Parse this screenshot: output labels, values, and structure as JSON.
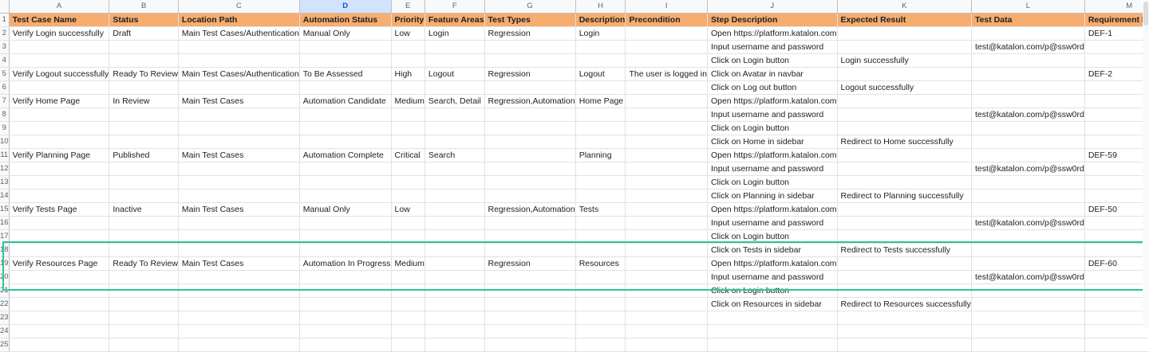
{
  "columns": [
    "A",
    "B",
    "C",
    "D",
    "E",
    "F",
    "G",
    "H",
    "I",
    "J",
    "K",
    "L",
    "M"
  ],
  "selected_column": "D",
  "header": [
    "Test Case Name",
    "Status",
    "Location Path",
    "Automation Status",
    "Priority",
    "Feature Areas",
    "Test Types",
    "Description",
    "Precondition",
    "Step Description",
    "Expected Result",
    "Test Data",
    "Requirement Linkage"
  ],
  "rows": [
    [
      "Verify Login successfully",
      "Draft",
      "Main Test Cases/Authentication",
      "Manual Only",
      "Low",
      "Login",
      "Regression",
      "Login",
      "",
      "Open https://platform.katalon.com",
      "",
      "",
      "DEF-1"
    ],
    [
      "",
      "",
      "",
      "",
      "",
      "",
      "",
      "",
      "",
      "Input username and password",
      "",
      "test@katalon.com/p@ssw0rd",
      ""
    ],
    [
      "",
      "",
      "",
      "",
      "",
      "",
      "",
      "",
      "",
      "Click on Login button",
      "Login successfully",
      "",
      ""
    ],
    [
      "Verify Logout successfully",
      "Ready To Review",
      "Main Test Cases/Authentication",
      "To Be Assessed",
      "High",
      "Logout",
      "Regression",
      "Logout",
      "The user is logged in",
      "Click on Avatar in navbar",
      "",
      "",
      "DEF-2"
    ],
    [
      "",
      "",
      "",
      "",
      "",
      "",
      "",
      "",
      "",
      "Click on Log out button",
      "Logout successfully",
      "",
      ""
    ],
    [
      "Verify Home Page",
      "In Review",
      "Main Test Cases",
      "Automation Candidate",
      "Medium",
      "Search, Detail",
      "Regression,Automation",
      "Home Page",
      "",
      "Open https://platform.katalon.com",
      "",
      "",
      ""
    ],
    [
      "",
      "",
      "",
      "",
      "",
      "",
      "",
      "",
      "",
      "Input username and password",
      "",
      "test@katalon.com/p@ssw0rd",
      ""
    ],
    [
      "",
      "",
      "",
      "",
      "",
      "",
      "",
      "",
      "",
      "Click on Login button",
      "",
      "",
      ""
    ],
    [
      "",
      "",
      "",
      "",
      "",
      "",
      "",
      "",
      "",
      "Click on Home in sidebar",
      "Redirect to Home successfully",
      "",
      ""
    ],
    [
      "Verify Planning Page",
      "Published",
      "Main Test Cases",
      "Automation Complete",
      "Critical",
      "Search",
      "",
      "Planning",
      "",
      "Open https://platform.katalon.com",
      "",
      "",
      "DEF-59"
    ],
    [
      "",
      "",
      "",
      "",
      "",
      "",
      "",
      "",
      "",
      "Input username and password",
      "",
      "test@katalon.com/p@ssw0rd",
      ""
    ],
    [
      "",
      "",
      "",
      "",
      "",
      "",
      "",
      "",
      "",
      "Click on Login button",
      "",
      "",
      ""
    ],
    [
      "",
      "",
      "",
      "",
      "",
      "",
      "",
      "",
      "",
      "Click on Planning in sidebar",
      "Redirect to Planning successfully",
      "",
      ""
    ],
    [
      "Verify Tests Page",
      "Inactive",
      "Main Test Cases",
      "Manual Only",
      "Low",
      "",
      "Regression,Automation",
      "Tests",
      "",
      "Open https://platform.katalon.com",
      "",
      "",
      "DEF-50"
    ],
    [
      "",
      "",
      "",
      "",
      "",
      "",
      "",
      "",
      "",
      "Input username and password",
      "",
      "test@katalon.com/p@ssw0rd",
      ""
    ],
    [
      "",
      "",
      "",
      "",
      "",
      "",
      "",
      "",
      "",
      "Click on Login button",
      "",
      "",
      ""
    ],
    [
      "",
      "",
      "",
      "",
      "",
      "",
      "",
      "",
      "",
      "Click on Tests in sidebar",
      "Redirect to Tests successfully",
      "",
      ""
    ],
    [
      "Verify Resources Page",
      "Ready To Review",
      "Main Test Cases",
      "Automation In Progress",
      "Medium",
      "",
      "Regression",
      "Resources",
      "",
      "Open https://platform.katalon.com",
      "",
      "",
      "DEF-60"
    ],
    [
      "",
      "",
      "",
      "",
      "",
      "",
      "",
      "",
      "",
      "Input username and password",
      "",
      "test@katalon.com/p@ssw0rd",
      ""
    ],
    [
      "",
      "",
      "",
      "",
      "",
      "",
      "",
      "",
      "",
      "Click on Login button",
      "",
      "",
      ""
    ],
    [
      "",
      "",
      "",
      "",
      "",
      "",
      "",
      "",
      "",
      "Click on Resources in sidebar",
      "Redirect to Resources successfully",
      "",
      ""
    ],
    [
      "",
      "",
      "",
      "",
      "",
      "",
      "",
      "",
      "",
      "",
      "",
      "",
      ""
    ],
    [
      "",
      "",
      "",
      "",
      "",
      "",
      "",
      "",
      "",
      "",
      "",
      "",
      ""
    ],
    [
      "",
      "",
      "",
      "",
      "",
      "",
      "",
      "",
      "",
      "",
      "",
      "",
      ""
    ]
  ],
  "colors": {
    "header_fill": "#f6ad6e",
    "highlight_border": "#2bc59b",
    "selected_column": "#d3e3fd"
  }
}
